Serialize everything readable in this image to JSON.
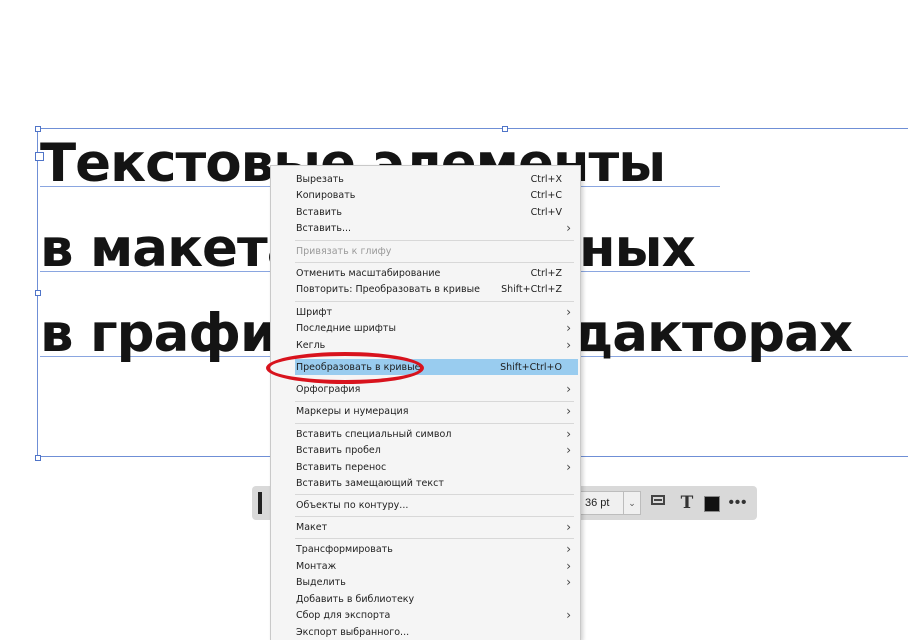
{
  "document": {
    "lines": [
      "Текстовые элементы",
      "в макетах, созданных",
      "в графических редакторах"
    ]
  },
  "toolbar": {
    "font_size": "36 pt",
    "icons": [
      "grip-icon",
      "chevron-down-icon",
      "frame-rect-icon",
      "text-style-icon",
      "fill-swatch-icon",
      "more-icon"
    ],
    "swatch_color": "#111111"
  },
  "context_menu": {
    "items": [
      {
        "label": "Вырезать",
        "shortcut": "Ctrl+X"
      },
      {
        "label": "Копировать",
        "shortcut": "Ctrl+C"
      },
      {
        "label": "Вставить",
        "shortcut": "Ctrl+V"
      },
      {
        "label": "Вставить...",
        "shortcut": ""
      },
      {
        "label": "Привязать к глифу",
        "shortcut": ""
      },
      {
        "label": "Отменить масштабирование",
        "shortcut": "Ctrl+Z"
      },
      {
        "label": "Повторить: Преобразовать в кривые",
        "shortcut": "Shift+Ctrl+Z"
      },
      {
        "label": "Шрифт",
        "shortcut": ""
      },
      {
        "label": "Последние шрифты",
        "shortcut": ""
      },
      {
        "label": "Кегль",
        "shortcut": ""
      },
      {
        "label": "Преобразовать в кривые",
        "shortcut": "Shift+Ctrl+O"
      },
      {
        "label": "Орфография",
        "shortcut": ""
      },
      {
        "label": "Маркеры и нумерация",
        "shortcut": ""
      },
      {
        "label": "Вставить специальный символ",
        "shortcut": ""
      },
      {
        "label": "Вставить пробел",
        "shortcut": ""
      },
      {
        "label": "Вставить перенос",
        "shortcut": ""
      },
      {
        "label": "Вставить замещающий текст",
        "shortcut": ""
      },
      {
        "label": "Объекты по контуру...",
        "shortcut": ""
      },
      {
        "label": "Макет",
        "shortcut": ""
      },
      {
        "label": "Трансформировать",
        "shortcut": ""
      },
      {
        "label": "Монтаж",
        "shortcut": ""
      },
      {
        "label": "Выделить",
        "shortcut": ""
      },
      {
        "label": "Добавить в библиотеку",
        "shortcut": ""
      },
      {
        "label": "Сбор для экспорта",
        "shortcut": ""
      },
      {
        "label": "Экспорт выбранного...",
        "shortcut": ""
      }
    ],
    "highlight_color": "#99ccef",
    "annotation_color": "#d8131d"
  }
}
